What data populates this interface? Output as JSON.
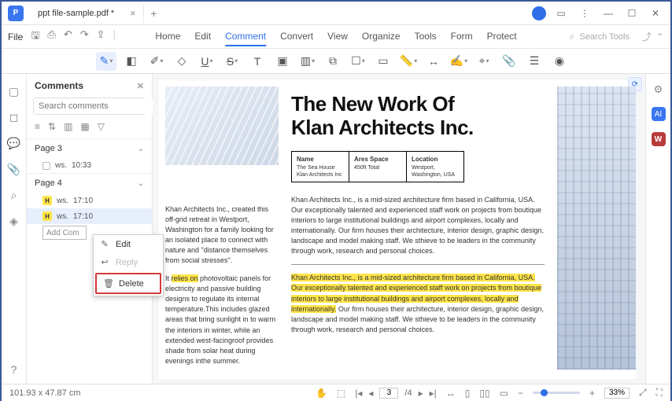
{
  "titlebar": {
    "tab_title": "ppt file-sample.pdf *"
  },
  "menubar": {
    "file": "File",
    "tabs": {
      "home": "Home",
      "edit": "Edit",
      "comment": "Comment",
      "convert": "Convert",
      "view": "View",
      "organize": "Organize",
      "tools": "Tools",
      "form": "Form",
      "protect": "Protect"
    },
    "search_placeholder": "Search Tools"
  },
  "comments": {
    "title": "Comments",
    "search_placeholder": "Search comments",
    "page3": {
      "label": "Page 3",
      "item": {
        "user": "ws.",
        "time": "10:33"
      }
    },
    "page4": {
      "label": "Page 4",
      "item1": {
        "user": "ws.",
        "time": "17:10"
      },
      "item2": {
        "user": "ws.",
        "time": "17:10"
      }
    },
    "add_comment": "Add Com"
  },
  "context_menu": {
    "edit": "Edit",
    "reply": "Reply",
    "delete": "Delete"
  },
  "document": {
    "title_line1": "The New Work Of",
    "title_line2": "Klan Architects Inc.",
    "table": {
      "name_h": "Name",
      "name_v": "The Sea House Klan Architects Inc",
      "area_h": "Ares Space",
      "area_v": "450ft Total",
      "loc_h": "Location",
      "loc_v": "Westport, Washington, USA"
    },
    "left_para1": "Khan Architects Inc., created this off-grid retreat in Westport, Washington for a family looking for an isolated place to connect with nature and \"distance themselves from social stresses\".",
    "left_para2_pre": "It ",
    "left_para2_hl": "relies on",
    "left_para2_post": " photovoltaic panels for electricity and passive building designs to regulate its internal temperature.This includes glazed areas that bring sunlight in to warm the interiors in winter, while an extended west-facingroof provides shade from solar heat during evenings inthe summer.",
    "mid_para1": "Khan Architects Inc., is a mid-sized architecture firm based in California, USA. Our exceptionally talented and experienced staff work on projects from boutique interiors to large institutional buildings and airport complexes, locally and internationally. Our firm houses their architecture, interior design, graphic design, landscape and model making staff. We sthieve to be leaders in the community through work, research and personal choices.",
    "mid_para2_hl": "Khan Architects Inc., is a mid-sized architecture firm based in California, USA. Our exceptionally talented and experienced staff work on projects from boutique interiors to large institutional buildings and airport complexes, locally and internationally.",
    "mid_para2_post": " Our firm houses their architecture, interior design, graphic design, landscape and model making staff. We sthieve to be leaders in the community through work, research and personal choices."
  },
  "statusbar": {
    "dimensions": "101.93 x 47.87 cm",
    "page_current": "3",
    "page_sep": "/4",
    "zoom_pct": "33%"
  }
}
